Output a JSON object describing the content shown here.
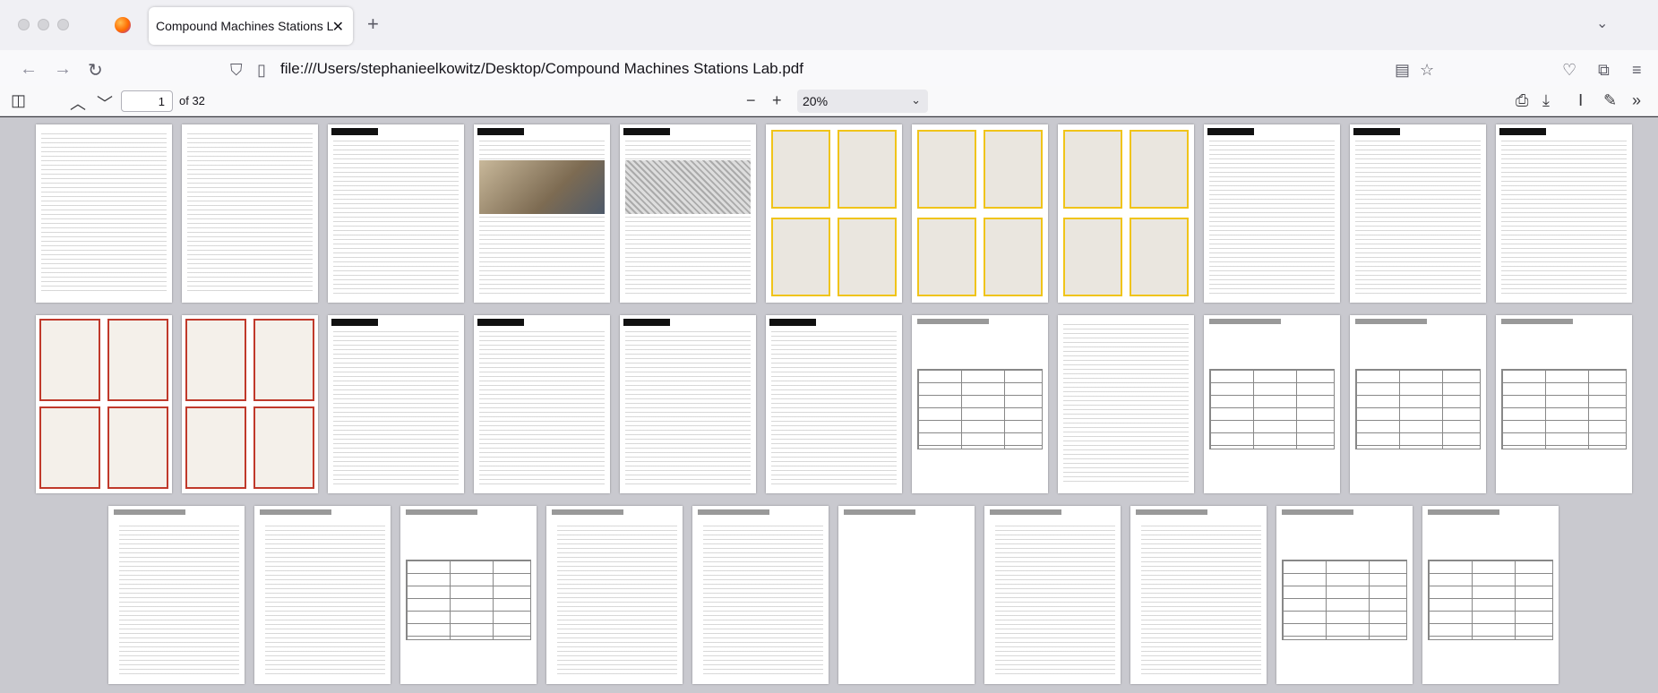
{
  "browser": {
    "tab_title": "Compound Machines Stations Lab.pdf",
    "tab_close_icon": "close-icon",
    "new_tab_icon": "plus-icon",
    "url": "file:///Users/stephanieelkowitz/Desktop/Compound Machines Stations Lab.pdf"
  },
  "pdf_toolbar": {
    "page_number": "1",
    "page_count": "of 32",
    "zoom_value": "20%"
  },
  "icons": {
    "sidebar": "sidebar-toggle-icon",
    "prev": "chevron-up-icon",
    "next": "chevron-down-icon",
    "zoom_out": "minus-icon",
    "zoom_in": "plus-icon",
    "print": "printer-icon",
    "save": "download-icon",
    "text_tool": "text-cursor-icon",
    "draw_tool": "pen-icon",
    "more": "double-chevron-right-icon"
  },
  "pages_rows": [
    [
      {
        "type": "text"
      },
      {
        "type": "text"
      },
      {
        "type": "station"
      },
      {
        "type": "station-photo"
      },
      {
        "type": "station-diagram"
      },
      {
        "type": "yellow-photos"
      },
      {
        "type": "yellow-photos"
      },
      {
        "type": "yellow-photos"
      },
      {
        "type": "station"
      },
      {
        "type": "station"
      },
      {
        "type": "station"
      }
    ],
    [
      {
        "type": "red-cards"
      },
      {
        "type": "red-cards"
      },
      {
        "type": "station"
      },
      {
        "type": "station"
      },
      {
        "type": "station"
      },
      {
        "type": "station"
      },
      {
        "type": "table"
      },
      {
        "type": "text"
      },
      {
        "type": "table"
      },
      {
        "type": "table"
      },
      {
        "type": "table"
      }
    ],
    [
      {
        "type": "lined"
      },
      {
        "type": "lined"
      },
      {
        "type": "table"
      },
      {
        "type": "lined"
      },
      {
        "type": "lined"
      },
      {
        "type": "blank"
      },
      {
        "type": "lined"
      },
      {
        "type": "lined"
      },
      {
        "type": "table"
      },
      {
        "type": "table"
      }
    ]
  ]
}
